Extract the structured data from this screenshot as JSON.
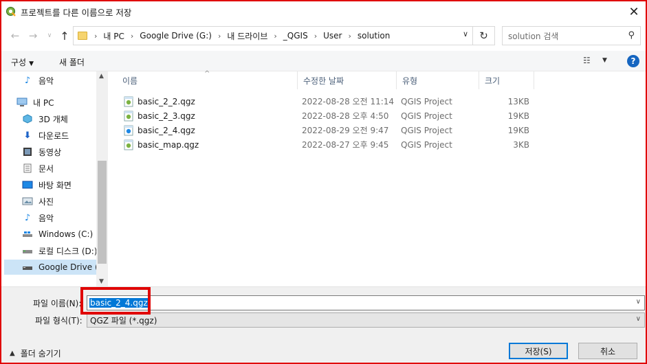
{
  "window": {
    "title": "프로젝트를 다른 이름으로 저장",
    "close_label": "✕"
  },
  "breadcrumb": [
    "내 PC",
    "Google Drive (G:)",
    "내 드라이브",
    "_QGIS",
    "User",
    "solution"
  ],
  "search": {
    "placeholder": "solution 검색"
  },
  "toolbar": {
    "organize_label": "구성",
    "new_folder_label": "새 폴더"
  },
  "sidebar": {
    "items": [
      {
        "label": "음악",
        "icon": "music-note-icon"
      },
      {
        "label": "내 PC",
        "icon": "pc-icon"
      },
      {
        "label": "3D 개체",
        "icon": "cube-icon"
      },
      {
        "label": "다운로드",
        "icon": "download-icon"
      },
      {
        "label": "동영상",
        "icon": "video-icon"
      },
      {
        "label": "문서",
        "icon": "document-icon"
      },
      {
        "label": "바탕 화면",
        "icon": "desktop-icon"
      },
      {
        "label": "사진",
        "icon": "picture-icon"
      },
      {
        "label": "음악",
        "icon": "music-note-icon"
      },
      {
        "label": "Windows (C:)",
        "icon": "drive-icon"
      },
      {
        "label": "로컬 디스크 (D:)",
        "icon": "drive-icon"
      },
      {
        "label": "Google Drive (G:)",
        "icon": "drive-icon"
      }
    ],
    "selected_index": 11
  },
  "columns": {
    "name": "이름",
    "modified": "수정한 날짜",
    "type": "유형",
    "size": "크기"
  },
  "files": [
    {
      "name": "basic_2_2.qgz",
      "modified": "2022-08-28 오전 11:14",
      "type": "QGIS Project",
      "size": "13KB"
    },
    {
      "name": "basic_2_3.qgz",
      "modified": "2022-08-28 오후 4:50",
      "type": "QGIS Project",
      "size": "19KB"
    },
    {
      "name": "basic_2_4.qgz",
      "modified": "2022-08-29 오전 9:47",
      "type": "QGIS Project",
      "size": "19KB"
    },
    {
      "name": "basic_map.qgz",
      "modified": "2022-08-27 오후 9:45",
      "type": "QGIS Project",
      "size": "3KB"
    }
  ],
  "form": {
    "filename_label": "파일 이름(N):",
    "filename_value": "basic_2_4.qgz",
    "filetype_label": "파일 형식(T):",
    "filetype_value": "QGZ 파일 (*.qgz)"
  },
  "footer": {
    "hide_folders_label": "폴더 숨기기",
    "save_label": "저장(S)",
    "cancel_label": "취소"
  },
  "colors": {
    "accent": "#0078d7",
    "highlight": "#e00000",
    "selected_bg": "#cce4f7"
  }
}
